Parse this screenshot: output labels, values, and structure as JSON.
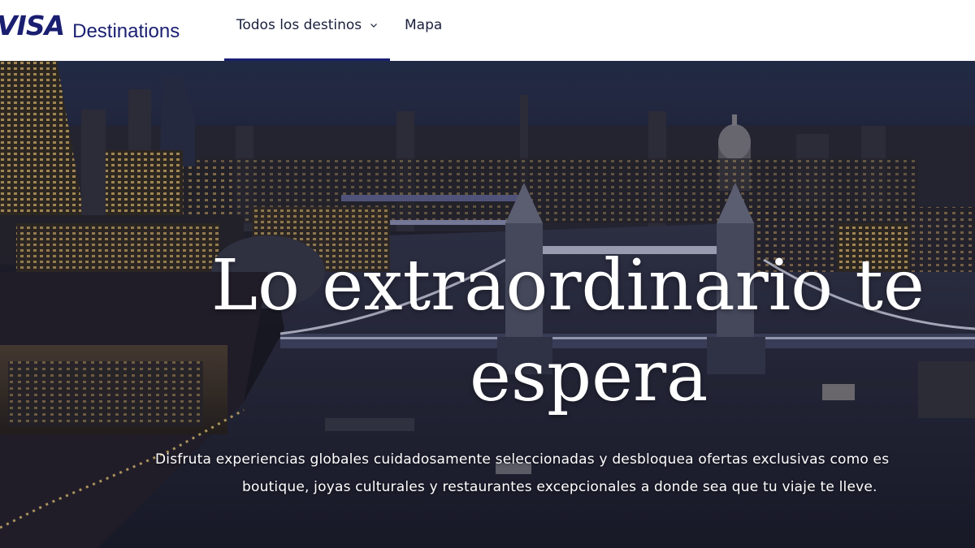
{
  "header": {
    "brand_logo": "VISA",
    "brand_name": "Destinations",
    "nav": {
      "all_destinations": "Todos los destinos",
      "map": "Mapa"
    },
    "accent_color": "#1a1f71"
  },
  "hero": {
    "title_line1": "Lo extraordinario te",
    "title_line2": "espera",
    "description_line1": "Disfruta experiencias globales cuidadosamente seleccionadas y desbloquea ofertas exclusivas como es",
    "description_line2": "boutique, joyas culturales y restaurantes excepcionales a donde sea que tu viaje te lleve."
  }
}
